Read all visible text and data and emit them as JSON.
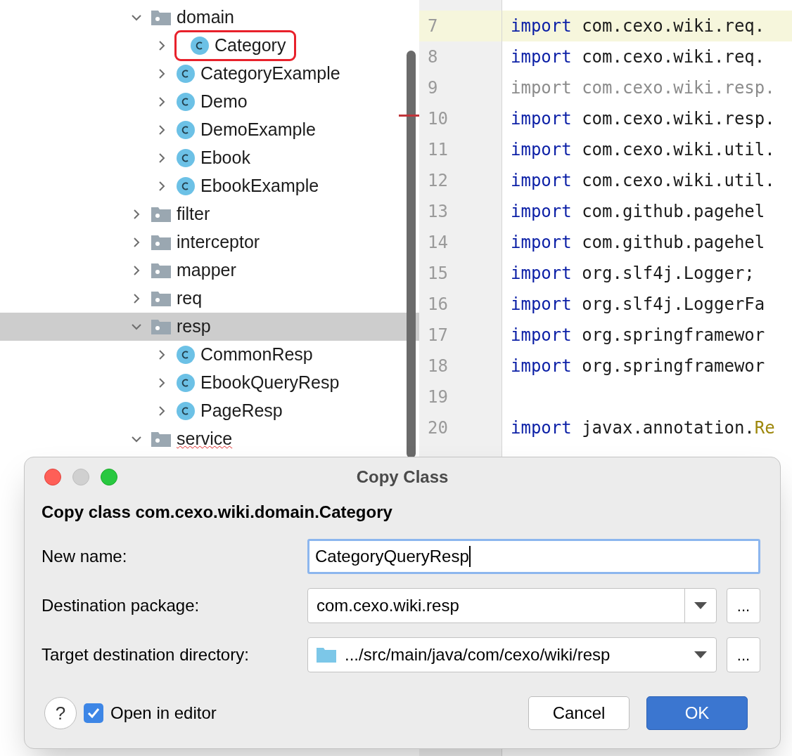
{
  "project_tree": {
    "items": [
      {
        "kind": "folder",
        "label": "domain",
        "expanded": true,
        "selected": false,
        "children": [
          {
            "kind": "class",
            "label": "Category",
            "expanded": false,
            "selected": false,
            "highlighted": true
          },
          {
            "kind": "class",
            "label": "CategoryExample",
            "expanded": false,
            "selected": false
          },
          {
            "kind": "class",
            "label": "Demo",
            "expanded": false,
            "selected": false
          },
          {
            "kind": "class",
            "label": "DemoExample",
            "expanded": false,
            "selected": false
          },
          {
            "kind": "class",
            "label": "Ebook",
            "expanded": false,
            "selected": false
          },
          {
            "kind": "class",
            "label": "EbookExample",
            "expanded": false,
            "selected": false
          }
        ]
      },
      {
        "kind": "folder",
        "label": "filter",
        "expanded": false,
        "selected": false
      },
      {
        "kind": "folder",
        "label": "interceptor",
        "expanded": false,
        "selected": false
      },
      {
        "kind": "folder",
        "label": "mapper",
        "expanded": false,
        "selected": false
      },
      {
        "kind": "folder",
        "label": "req",
        "expanded": false,
        "selected": false
      },
      {
        "kind": "folder",
        "label": "resp",
        "expanded": true,
        "selected": true,
        "children": [
          {
            "kind": "class",
            "label": "CommonResp",
            "expanded": false,
            "selected": false
          },
          {
            "kind": "class",
            "label": "EbookQueryResp",
            "expanded": false,
            "selected": false
          },
          {
            "kind": "class",
            "label": "PageResp",
            "expanded": false,
            "selected": false
          }
        ]
      },
      {
        "kind": "folder",
        "label": "service",
        "expanded": true,
        "selected": false,
        "spelling_error": true
      }
    ]
  },
  "editor": {
    "lines": [
      {
        "number": "7",
        "current": true,
        "unused": false,
        "keyword": "import",
        "code": "com.cexo.wiki.req."
      },
      {
        "number": "8",
        "current": false,
        "unused": false,
        "keyword": "import",
        "code": "com.cexo.wiki.req."
      },
      {
        "number": "9",
        "current": false,
        "unused": true,
        "keyword": "import",
        "code": "com.cexo.wiki.resp."
      },
      {
        "number": "10",
        "current": false,
        "unused": false,
        "keyword": "import",
        "code": "com.cexo.wiki.resp."
      },
      {
        "number": "11",
        "current": false,
        "unused": false,
        "keyword": "import",
        "code": "com.cexo.wiki.util."
      },
      {
        "number": "12",
        "current": false,
        "unused": false,
        "keyword": "import",
        "code": "com.cexo.wiki.util."
      },
      {
        "number": "13",
        "current": false,
        "unused": false,
        "keyword": "import",
        "code": "com.github.pagehel"
      },
      {
        "number": "14",
        "current": false,
        "unused": false,
        "keyword": "import",
        "code": "com.github.pagehel"
      },
      {
        "number": "15",
        "current": false,
        "unused": false,
        "keyword": "import",
        "code": "org.slf4j.Logger;"
      },
      {
        "number": "16",
        "current": false,
        "unused": false,
        "keyword": "import",
        "code": "org.slf4j.LoggerFa"
      },
      {
        "number": "17",
        "current": false,
        "unused": false,
        "keyword": "import",
        "code": "org.springframewor"
      },
      {
        "number": "18",
        "current": false,
        "unused": false,
        "keyword": "import",
        "code": "org.springframewor"
      },
      {
        "number": "19",
        "current": false
      },
      {
        "number": "20",
        "current": false,
        "unused": false,
        "keyword": "import",
        "code": "javax.annotation.",
        "class_name": "Re"
      }
    ]
  },
  "dialog": {
    "title": "Copy Class",
    "heading": "Copy class com.cexo.wiki.domain.Category",
    "new_name": {
      "label": "New name:",
      "value": "CategoryQueryResp"
    },
    "destination_package": {
      "label": "Destination package:",
      "value": "com.cexo.wiki.resp",
      "browse": "..."
    },
    "target_directory": {
      "label": "Target destination directory:",
      "value": ".../src/main/java/com/cexo/wiki/resp",
      "browse": "..."
    },
    "help": "?",
    "open_in_editor": {
      "label": "Open in editor",
      "checked": true
    },
    "buttons": [
      {
        "label": "Cancel",
        "kind": "secondary"
      },
      {
        "label": "OK",
        "kind": "primary"
      }
    ]
  }
}
